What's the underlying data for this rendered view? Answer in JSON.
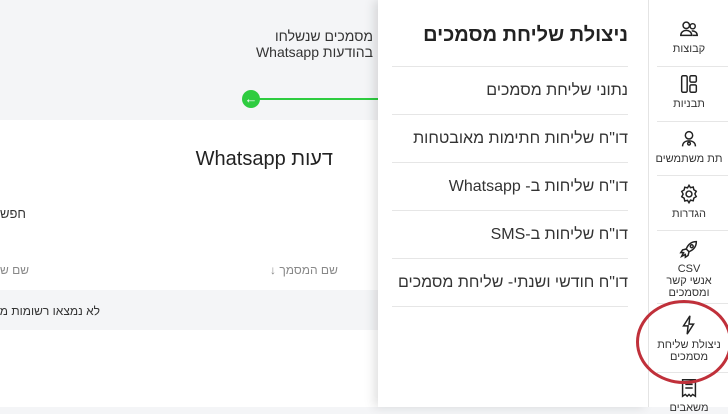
{
  "background": {
    "header_line1": "מסמכים שנשלחו",
    "header_line2": "בהודעות Whatsapp",
    "step_arrow": "←",
    "section_title": "דעות Whatsapp",
    "search_label": "חפש",
    "col_document_name": "שם המסמך",
    "col_sort_arrow": "↓",
    "col_name_partial": "שם ש",
    "empty_text": "לא נמצאו רשומות מה"
  },
  "panel": {
    "title": "ניצולת שליחת מסמכים",
    "items": [
      {
        "label": "נתוני שליחת מסמכים"
      },
      {
        "label": "דו\"ח שליחות חתימות מאובטחות"
      },
      {
        "label": "דו\"ח שליחות ב- Whatsapp"
      },
      {
        "label": "דו\"ח שליחות ב-SMS"
      },
      {
        "label": "דו\"ח חודשי ושנתי- שליחת מסמכים"
      }
    ]
  },
  "sidebar": {
    "items": [
      {
        "label": "קבוצות",
        "icon": "users-icon"
      },
      {
        "label": "תבניות",
        "icon": "layout-icon"
      },
      {
        "label": "תת משתמשים",
        "icon": "sub-users-icon"
      },
      {
        "label": "הגדרות",
        "icon": "gear-icon"
      },
      {
        "label_line1": "CSV",
        "label_line2": "אנשי קשר",
        "label_line3": "ומסמכים",
        "icon": "rocket-icon"
      },
      {
        "label_line1": "ניצולת שליחת",
        "label_line2": "מסמכים",
        "icon": "lightning-icon"
      },
      {
        "label": "משאבים",
        "icon": "receipt-icon"
      }
    ]
  },
  "colors": {
    "accent_green": "#2ecc40",
    "highlight_circle": "#c0303a"
  }
}
